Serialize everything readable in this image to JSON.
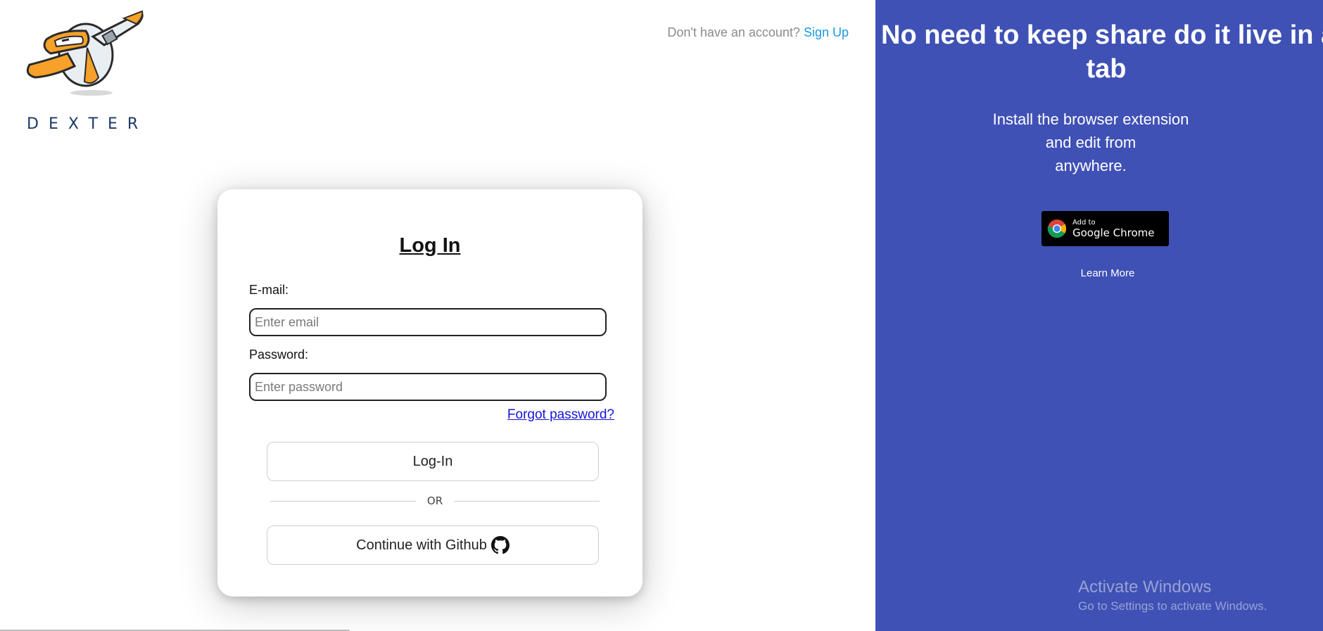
{
  "brand": {
    "name": "DEXTER",
    "logo_icon": "dexter-robot-logo-icon"
  },
  "header": {
    "signup_prompt": "Don't have an account?",
    "signup_link": "Sign Up"
  },
  "login": {
    "title": "Log In",
    "email_label": "E-mail:",
    "email_placeholder": "Enter email",
    "password_label": "Password:",
    "password_placeholder": "Enter password",
    "forgot_link": "Forgot password?",
    "login_button": "Log-In",
    "divider": "OR",
    "github_button": "Continue with Github",
    "github_icon": "github-icon"
  },
  "promo": {
    "title_line1": "No need to keep share do it live in a",
    "title_line2": "tab",
    "text_line1": "Install the browser extension",
    "text_line2": "and edit from",
    "text_line3": "anywhere.",
    "badge_small": "Add to",
    "badge_big": "Google Chrome",
    "badge_icon": "chrome-icon",
    "learn_more": "Learn More",
    "background_color": "#3f51b5"
  },
  "watermark": {
    "title": "Activate Windows",
    "subtitle": "Go to Settings to activate Windows."
  }
}
